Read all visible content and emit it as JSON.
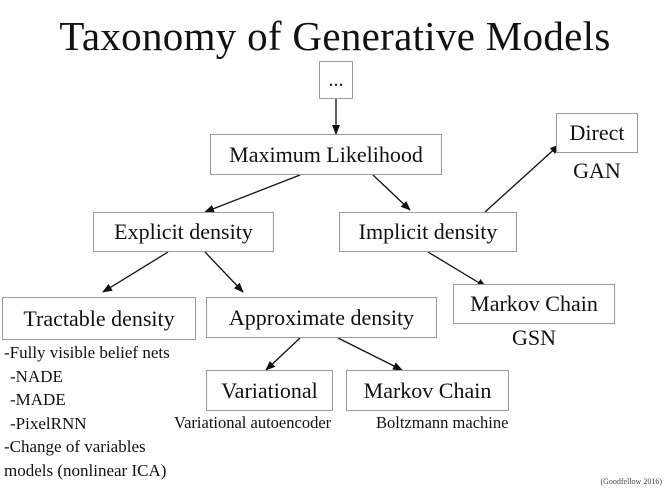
{
  "title": "Taxonomy of Generative Models",
  "nodes": {
    "root": "...",
    "maximum_likelihood": "Maximum Likelihood",
    "explicit_density": "Explicit density",
    "implicit_density": "Implicit density",
    "direct": "Direct",
    "tractable_density": "Tractable density",
    "approximate_density": "Approximate density",
    "markov_chain_implicit": "Markov Chain",
    "variational": "Variational",
    "markov_chain_approx": "Markov Chain"
  },
  "examples": {
    "direct": "GAN",
    "markov_chain_implicit": "GSN",
    "variational": "Variational autoencoder",
    "markov_chain_approx": "Boltzmann machine"
  },
  "tractable_examples": [
    "-Fully visible belief nets",
    "-NADE",
    "-MADE",
    "-PixelRNN",
    "-Change of variables",
    "models (nonlinear ICA)"
  ],
  "citation": "(Goodfellow 2016)"
}
